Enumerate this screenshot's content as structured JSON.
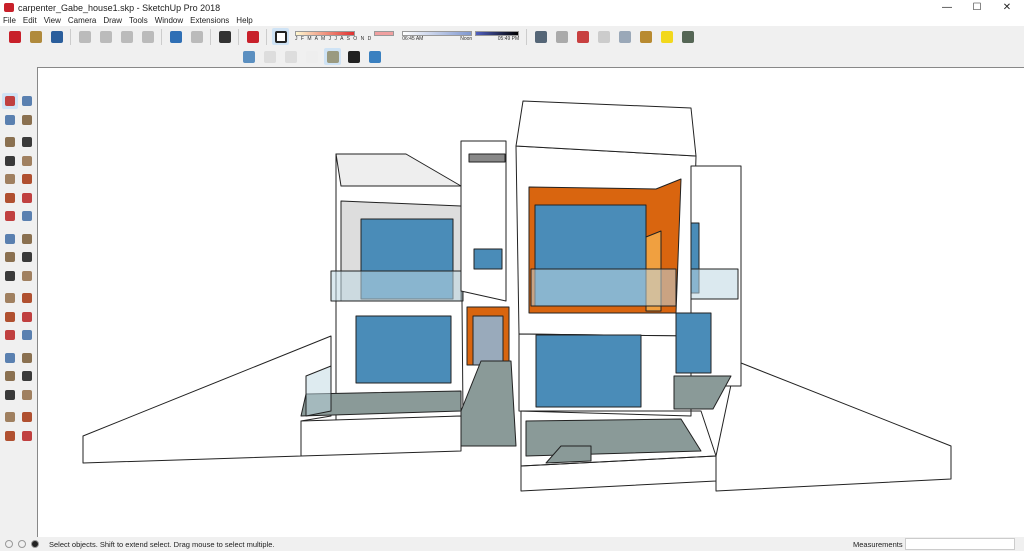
{
  "window": {
    "title": "carpenter_Gabe_house1.skp - SketchUp Pro 2018",
    "minimize": "—",
    "maximize": "☐",
    "close": "✕"
  },
  "menu": [
    "File",
    "Edit",
    "View",
    "Camera",
    "Draw",
    "Tools",
    "Window",
    "Extensions",
    "Help"
  ],
  "toolbar_main": [
    {
      "name": "new-icon",
      "color": "#c8202a"
    },
    {
      "name": "open-folder-icon",
      "color": "#b08a3c"
    },
    {
      "name": "save-icon",
      "color": "#2a5e9c"
    },
    "sep",
    {
      "name": "cut-icon",
      "color": "#bbbbbb"
    },
    {
      "name": "copy-icon",
      "color": "#bbbbbb"
    },
    {
      "name": "paste-icon",
      "color": "#bbbbbb"
    },
    {
      "name": "erase-icon",
      "color": "#bbbbbb"
    },
    "sep",
    {
      "name": "undo-icon",
      "color": "#2f6fb5"
    },
    {
      "name": "redo-icon",
      "color": "#bbbbbb"
    },
    "sep",
    {
      "name": "print-icon",
      "color": "#333333"
    },
    "sep",
    {
      "name": "model-info-icon",
      "color": "#c8202a"
    },
    "sep"
  ],
  "shadows": {
    "toggle_icon": "shadow-toggle-icon",
    "months": "J F M A M J J A S O N D",
    "time_start": "06:45 AM",
    "time_mid": "Noon",
    "time_end": "05:49 PM"
  },
  "toolbar_extra": [
    {
      "name": "match-photo-icon",
      "color": "#556677"
    },
    {
      "name": "section-plane-icon",
      "color": "#aaaaaa"
    },
    {
      "name": "component-icon",
      "color": "#c84040"
    },
    {
      "name": "fog-icon",
      "color": "#cccccc"
    },
    {
      "name": "wrench-icon",
      "color": "#9aa8b8"
    },
    {
      "name": "warehouse-icon",
      "color": "#b88a30"
    },
    {
      "name": "lightbulb-icon",
      "color": "#f2d81c"
    },
    {
      "name": "extension-icon",
      "color": "#556655"
    }
  ],
  "styles_toolbar": [
    {
      "name": "xray-icon",
      "color": "#5b8fc0"
    },
    {
      "name": "back-edges-icon",
      "color": "#dddddd"
    },
    {
      "name": "wireframe-icon",
      "color": "#dddddd"
    },
    {
      "name": "hidden-line-icon",
      "color": "#eeeeee"
    },
    {
      "name": "shaded-icon",
      "color": "#9a9a80",
      "selected": true
    },
    {
      "name": "shaded-textures-icon",
      "color": "#222222"
    },
    {
      "name": "monochrome-icon",
      "color": "#3a80c0"
    }
  ],
  "left_tools": [
    [
      "select-icon",
      "component-icon"
    ],
    [
      "paint-bucket-icon",
      "eraser-icon"
    ],
    [
      "line-icon",
      "freehand-icon"
    ],
    [
      "rectangle-icon",
      "rotated-rectangle-icon"
    ],
    [
      "circle-icon",
      "polygon-icon"
    ],
    [
      "arc-icon",
      "two-point-arc-icon"
    ],
    [
      "three-point-arc-icon",
      "pie-icon"
    ],
    [
      "move-icon",
      "push-pull-icon"
    ],
    [
      "rotate-icon",
      "follow-me-icon"
    ],
    [
      "scale-icon",
      "offset-icon"
    ],
    [
      "tape-measure-icon",
      "dimension-icon"
    ],
    [
      "protractor-icon",
      "text-icon"
    ],
    [
      "axes-icon",
      "3d-text-icon"
    ],
    [
      "orbit-icon",
      "pan-icon"
    ],
    [
      "zoom-icon",
      "zoom-window-icon"
    ],
    [
      "zoom-extents-icon",
      "previous-view-icon"
    ],
    [
      "position-camera-icon",
      "look-around-icon"
    ],
    [
      "walk-icon",
      "section-plane-icon"
    ]
  ],
  "status": {
    "text": "Select objects. Shift to extend select. Drag mouse to select multiple.",
    "measurements_label": "Measurements",
    "measurements_value": ""
  },
  "colors": {
    "glass": "#4a8cb8",
    "accent_orange": "#d9650f",
    "wall": "#ffffff",
    "floor": "#8a9a98"
  }
}
